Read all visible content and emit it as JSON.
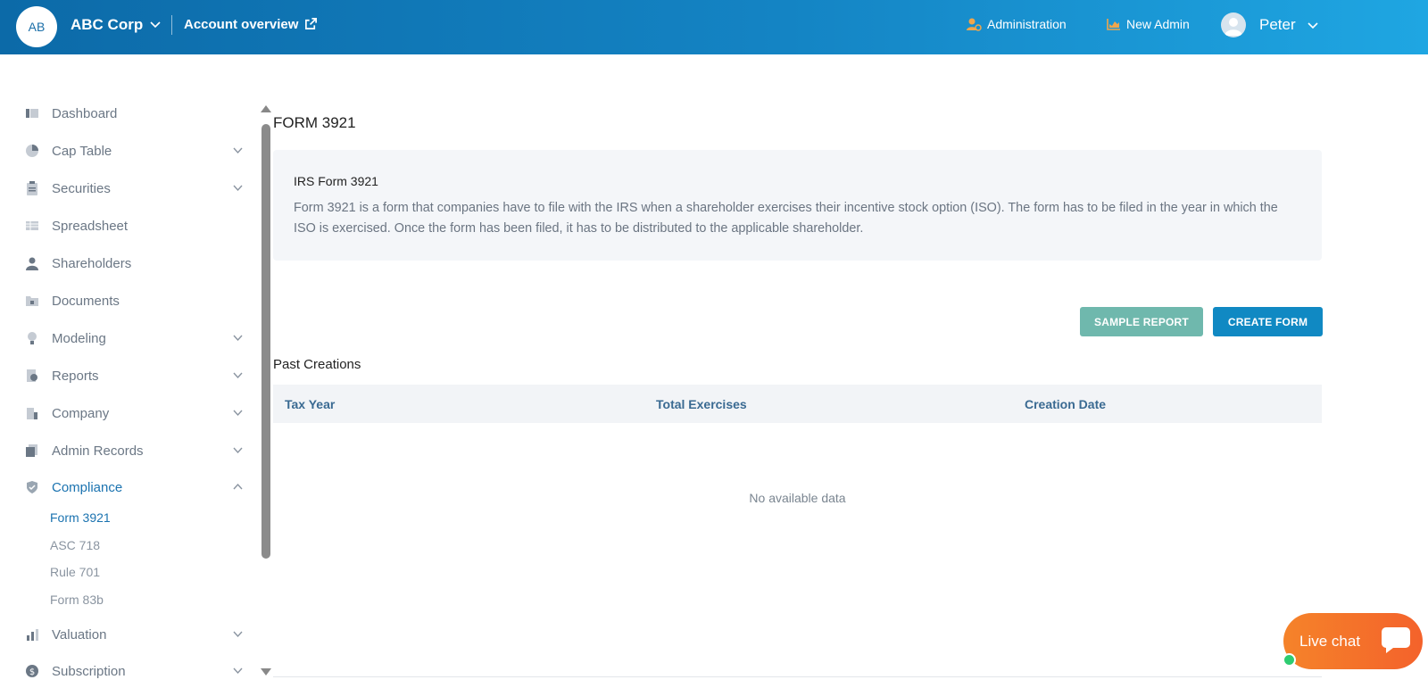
{
  "header": {
    "company_initials": "AB",
    "company_name": "ABC Corp",
    "account_link": "Account overview",
    "administration": "Administration",
    "new_admin": "New Admin",
    "user_name": "Peter"
  },
  "sidebar": {
    "items": [
      {
        "label": "Dashboard"
      },
      {
        "label": "Cap Table"
      },
      {
        "label": "Securities"
      },
      {
        "label": "Spreadsheet"
      },
      {
        "label": "Shareholders"
      },
      {
        "label": "Documents"
      },
      {
        "label": "Modeling"
      },
      {
        "label": "Reports"
      },
      {
        "label": "Company"
      },
      {
        "label": "Admin Records"
      },
      {
        "label": "Compliance"
      },
      {
        "label": "Valuation"
      },
      {
        "label": "Subscription"
      }
    ],
    "compliance_sub": [
      {
        "label": "Form 3921"
      },
      {
        "label": "ASC 718"
      },
      {
        "label": "Rule 701"
      },
      {
        "label": "Form 83b"
      }
    ]
  },
  "main": {
    "page_title": "FORM 3921",
    "info_title": "IRS Form 3921",
    "info_text": "Form 3921 is a form that companies have to file with the IRS when a shareholder exercises their incentive stock option (ISO). The form has to be filed in the year in which the ISO is exercised. Once the form has been filed, it has to be distributed to the applicable shareholder.",
    "sample_report": "SAMPLE REPORT",
    "create_form": "CREATE FORM",
    "past_creations": "Past Creations",
    "table": {
      "headers": [
        "Tax Year",
        "Total Exercises",
        "Creation Date"
      ],
      "empty_message": "No available data"
    }
  },
  "live_chat": {
    "label": "Live chat"
  },
  "colors": {
    "accent": "#1089c3",
    "sample_button": "#6fb8ad",
    "chat": "#f4622b",
    "active_nav": "#1b73b0"
  }
}
